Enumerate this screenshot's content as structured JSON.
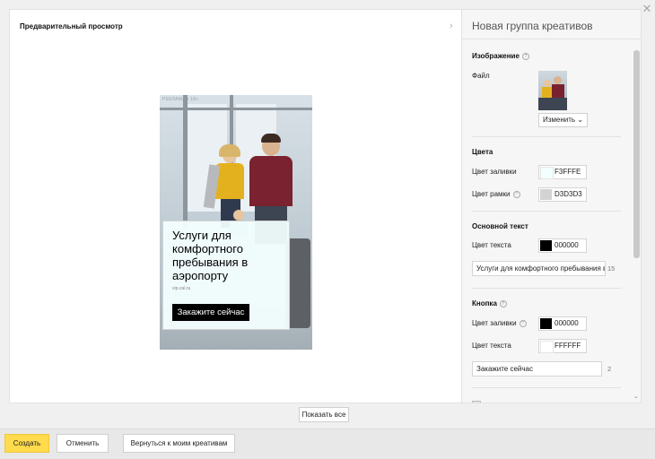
{
  "preview": {
    "title": "Предварительный просмотр",
    "collapse_icon": "chevron-right-icon"
  },
  "ad": {
    "age_label": "РЕКЛАМА • 18+",
    "headline": "Услуги для комфортного пребывания в аэропорту",
    "domain": "vip-zal.ru",
    "button_label": "Закажите сейчас"
  },
  "panel": {
    "title": "Новая группа креативов",
    "image": {
      "section_title": "Изображение",
      "file_label": "Файл",
      "change_button": "Изменить"
    },
    "colors": {
      "section_title": "Цвета",
      "fill_label": "Цвет заливки",
      "fill_value": "F3FFFE",
      "border_label": "Цвет рамки",
      "border_value": "D3D3D3"
    },
    "main_text": {
      "section_title": "Основной текст",
      "text_color_label": "Цвет текста",
      "text_color_value": "000000",
      "text_value": "Услуги для комфортного пребывания в",
      "count": "15"
    },
    "button": {
      "section_title": "Кнопка",
      "fill_label": "Цвет заливки",
      "fill_value": "000000",
      "text_color_label": "Цвет текста",
      "text_color_value": "FFFFFF",
      "text_value": "Закажите сейчас",
      "count": "2"
    }
  },
  "show_all": "Показать все",
  "footer": {
    "create": "Создать",
    "cancel": "Отменить",
    "back": "Вернуться к моим креативам"
  },
  "colors": {
    "fill": "#f3fffe",
    "border": "#d3d3d3",
    "text": "#000000",
    "button_fill": "#000000",
    "button_text": "#ffffff",
    "primary": "#ffdb4d"
  }
}
